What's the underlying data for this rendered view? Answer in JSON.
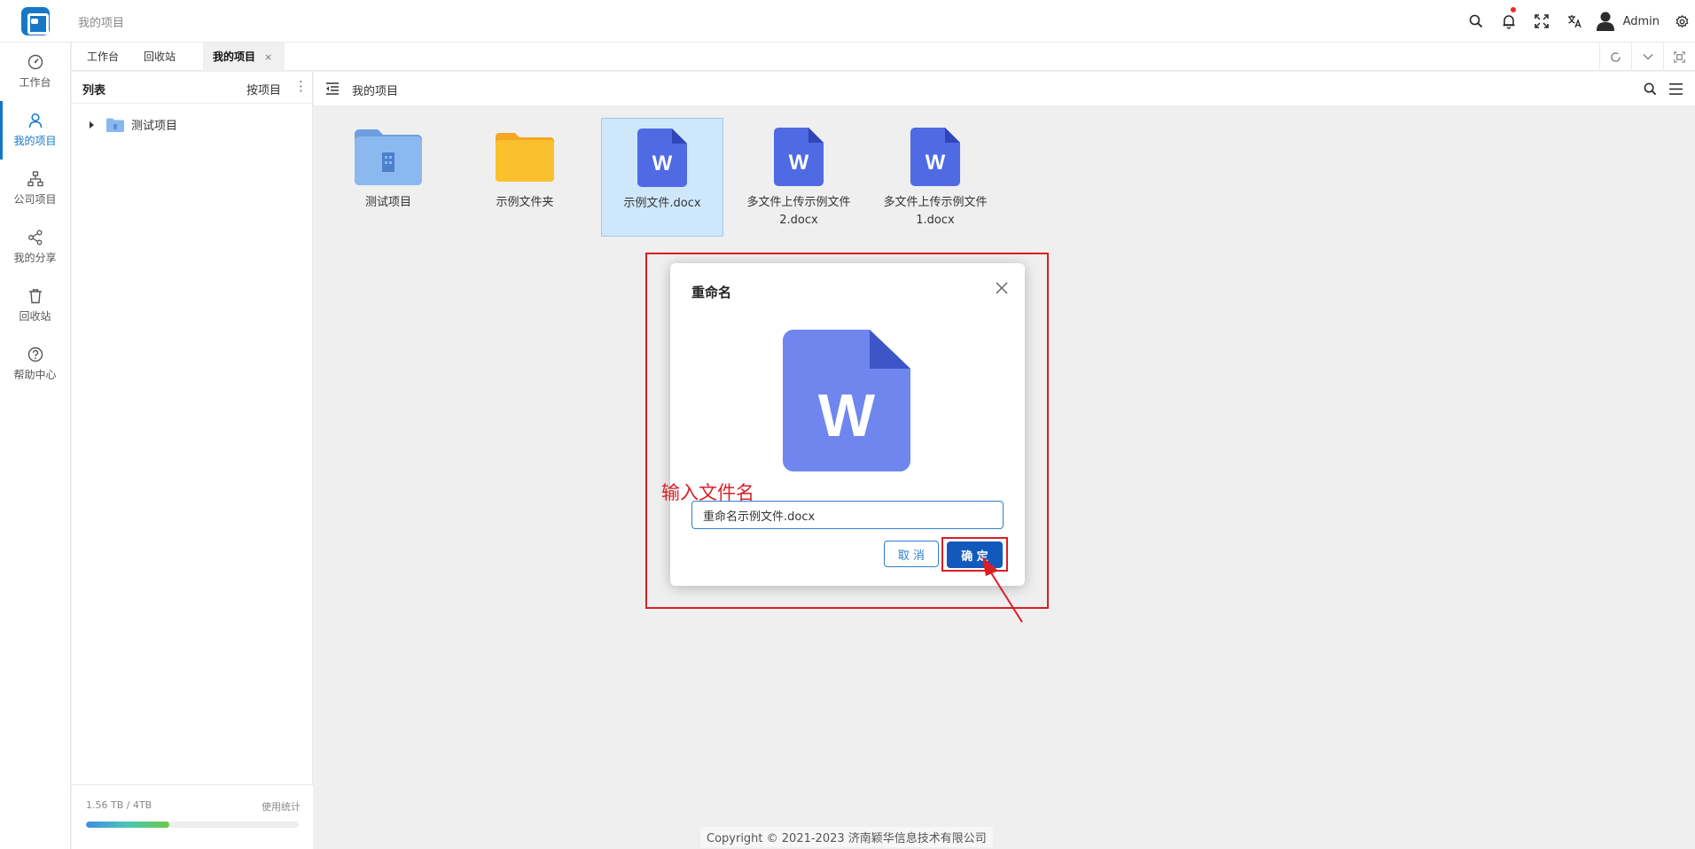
{
  "header": {
    "title": "我的项目",
    "user_name": "Admin",
    "notification_dot_color": "#f5222d"
  },
  "sidebar": {
    "items": [
      {
        "label": "工作台",
        "icon": "dashboard-icon"
      },
      {
        "label": "我的项目",
        "icon": "user-icon",
        "active": true
      },
      {
        "label": "公司项目",
        "icon": "org-icon"
      },
      {
        "label": "我的分享",
        "icon": "share-icon"
      },
      {
        "label": "回收站",
        "icon": "trash-icon"
      },
      {
        "label": "帮助中心",
        "icon": "help-icon"
      }
    ]
  },
  "tabs": [
    {
      "label": "工作台"
    },
    {
      "label": "回收站"
    },
    {
      "label": "我的项目",
      "active": true,
      "close": "×"
    }
  ],
  "panel": {
    "title": "列表",
    "sort_label": "按项目",
    "more": "⋮",
    "tree": [
      {
        "label": "测试项目"
      }
    ],
    "storage": {
      "text": "1.56 TB / 4TB",
      "stat_label": "使用统计",
      "usage_fraction": 0.39
    }
  },
  "content": {
    "title": "我的项目",
    "files": [
      {
        "name": "测试项目",
        "type": "project-folder"
      },
      {
        "name": "示例文件夹",
        "type": "folder"
      },
      {
        "name": "示例文件.docx",
        "type": "word",
        "selected": true
      },
      {
        "name": "多文件上传示例文件2.docx",
        "type": "word"
      },
      {
        "name": "多文件上传示例文件1.docx",
        "type": "word"
      }
    ],
    "copyright": "Copyright © 2021-2023 济南颖华信息技术有限公司"
  },
  "dialog": {
    "title": "重命名",
    "input_value": "重命名示例文件.docx",
    "cancel_label": "取 消",
    "confirm_label": "确 定",
    "file_icon_letter": "W"
  },
  "annotation": {
    "label": "输入文件名",
    "color": "#d91f24"
  },
  "colors": {
    "primary": "#1677c7",
    "word_icon": "#4f6ae3",
    "folder_yellow": "#fbc02d",
    "folder_blue": "#79aeea"
  }
}
